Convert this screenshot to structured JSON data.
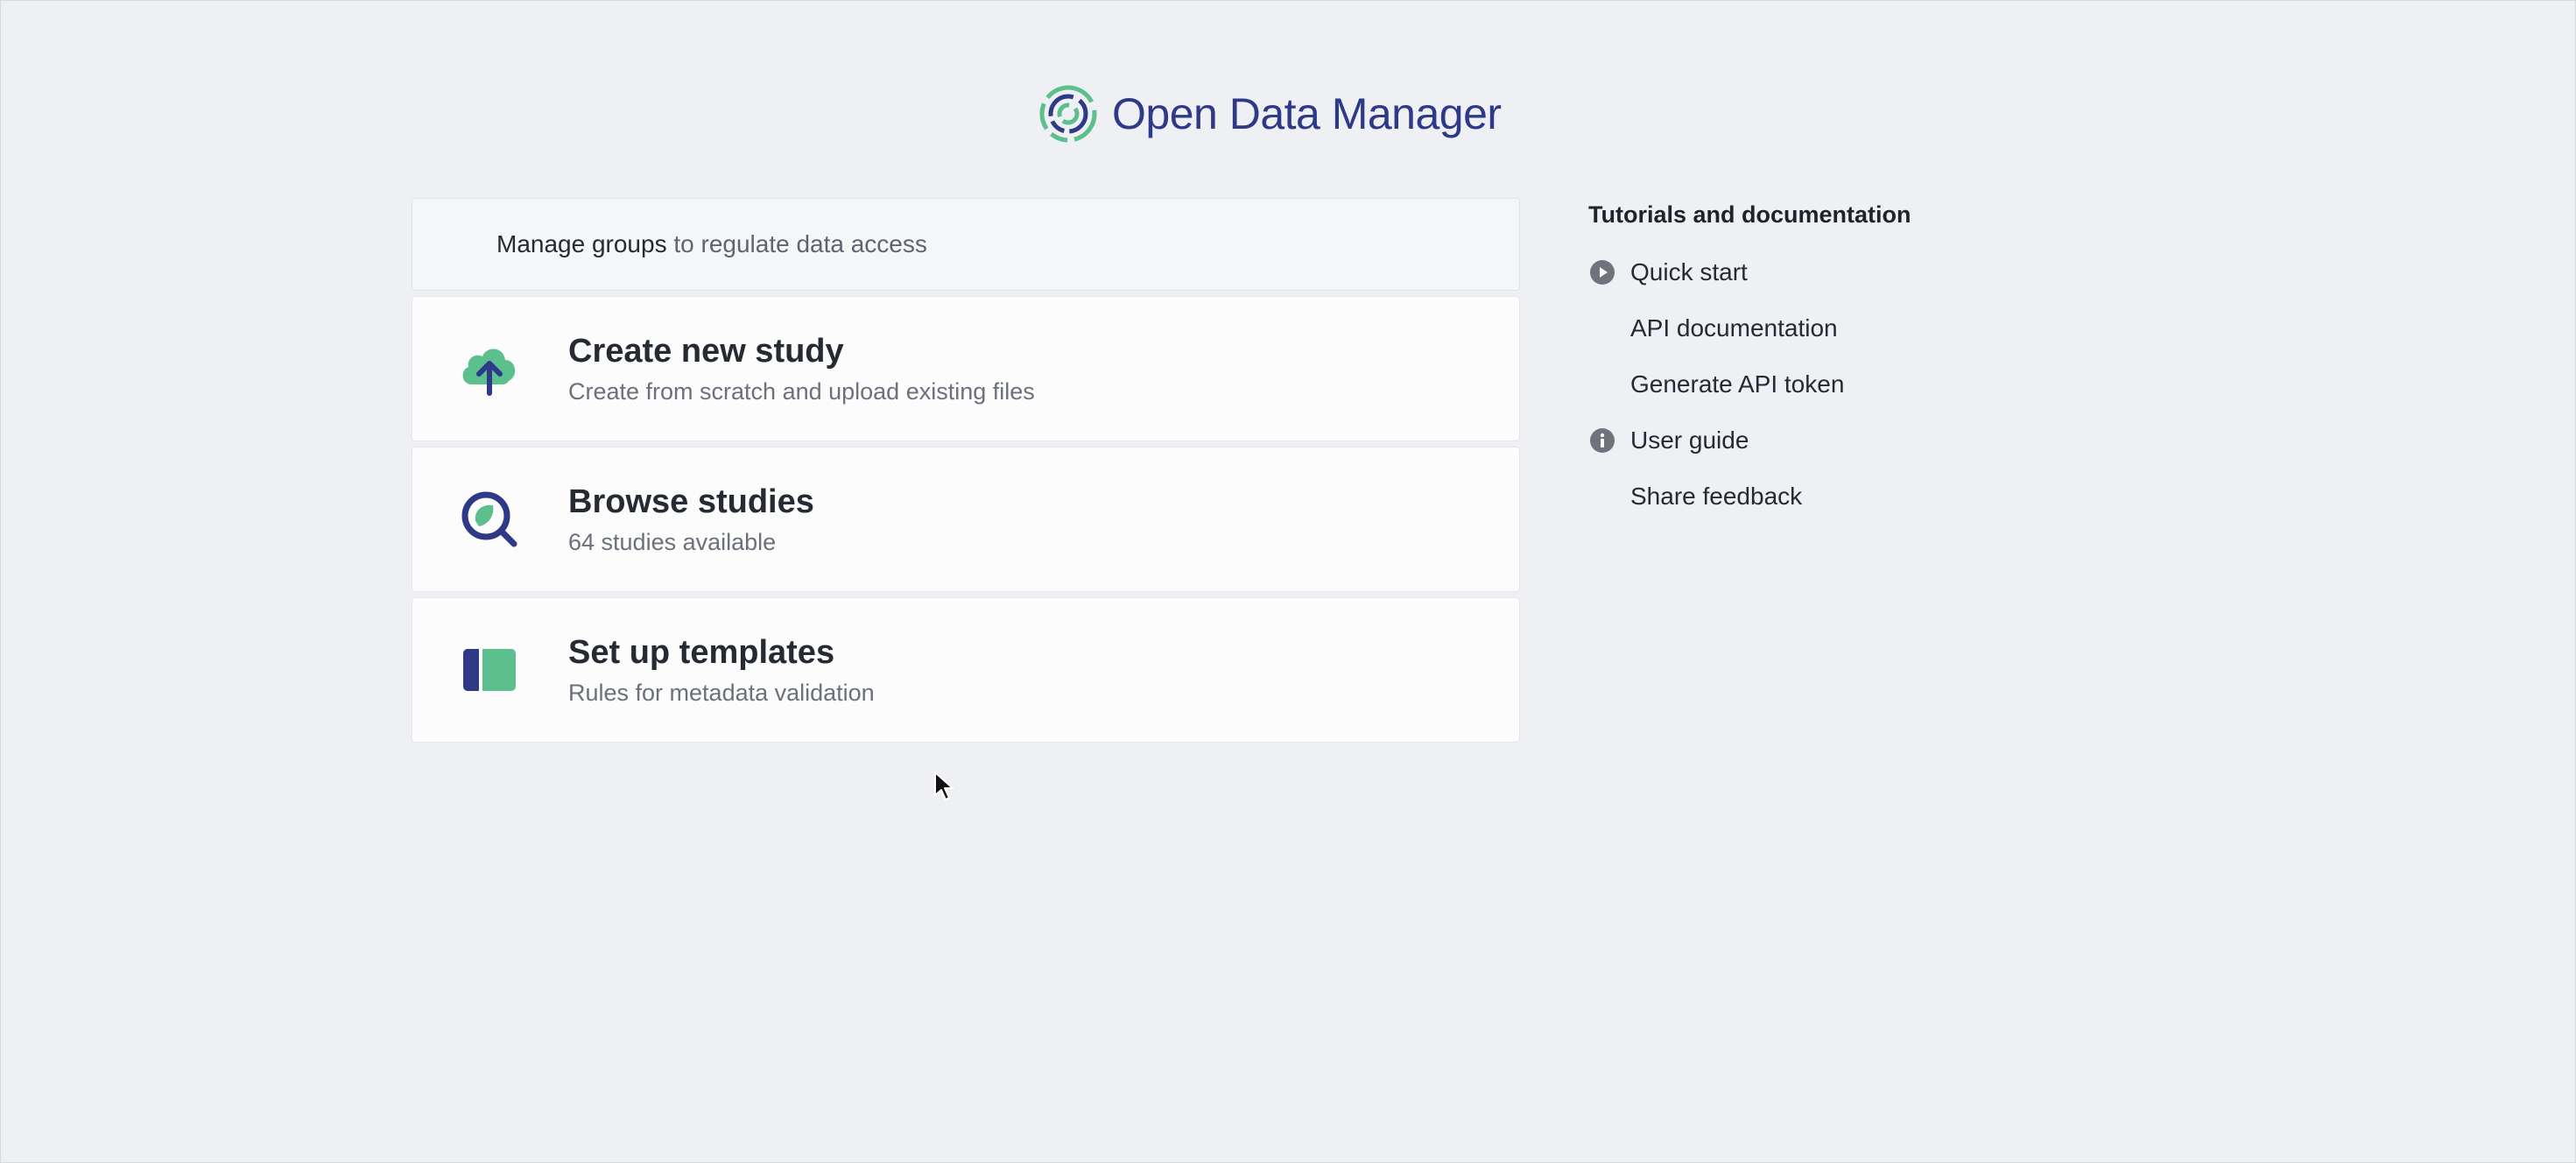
{
  "brand": {
    "name": "Open Data Manager",
    "primary_color": "#2e3a87",
    "accent_color": "#5bbf8e"
  },
  "groups_banner": {
    "link_text": "Manage groups",
    "rest_text": " to regulate data access"
  },
  "cards": [
    {
      "icon": "cloud-upload-icon",
      "title": "Create new study",
      "subtitle": "Create from scratch and upload existing files"
    },
    {
      "icon": "search-study-icon",
      "title": "Browse studies",
      "subtitle": "64 studies available"
    },
    {
      "icon": "template-icon",
      "title": "Set up templates",
      "subtitle": "Rules for metadata validation"
    }
  ],
  "sidebar": {
    "heading": "Tutorials and documentation",
    "items": [
      {
        "label": "Quick start",
        "icon": "play-circle-icon"
      },
      {
        "label": "API documentation",
        "icon": ""
      },
      {
        "label": "Generate API token",
        "icon": ""
      },
      {
        "label": "User guide",
        "icon": "info-circle-icon"
      },
      {
        "label": "Share feedback",
        "icon": ""
      }
    ]
  }
}
